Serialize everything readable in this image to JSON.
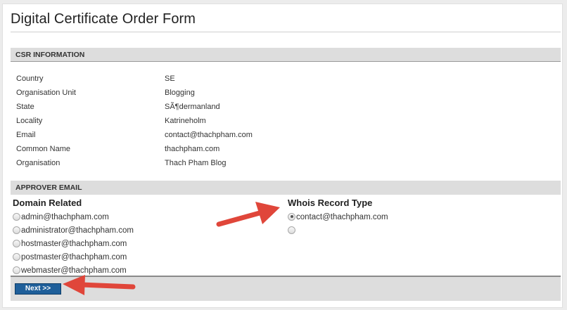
{
  "page": {
    "title": "Digital Certificate Order Form"
  },
  "csr": {
    "heading": "CSR INFORMATION",
    "rows": [
      {
        "label": "Country",
        "value": "SE"
      },
      {
        "label": "Organisation Unit",
        "value": "Blogging"
      },
      {
        "label": "State",
        "value": "SÃ¶dermanland"
      },
      {
        "label": "Locality",
        "value": "Katrineholm"
      },
      {
        "label": "Email",
        "value": "contact@thachpham.com"
      },
      {
        "label": "Common Name",
        "value": "thachpham.com"
      },
      {
        "label": "Organisation",
        "value": "Thach Pham Blog"
      }
    ]
  },
  "approver": {
    "heading": "APPROVER EMAIL",
    "domain_related": {
      "heading": "Domain Related",
      "options": [
        "admin@thachpham.com",
        "administrator@thachpham.com",
        "hostmaster@thachpham.com",
        "postmaster@thachpham.com",
        "webmaster@thachpham.com"
      ]
    },
    "whois": {
      "heading": "Whois Record Type",
      "options": [
        "contact@thachpham.com",
        ""
      ],
      "selected_index": 0
    }
  },
  "footer": {
    "next_label": "Next >>"
  },
  "colors": {
    "section_background": "#dddddd",
    "button_background": "#1f5f9a",
    "annotation_arrow": "#e0463a"
  },
  "icons": [
    "radio-button-icon",
    "annotation-arrow-icon"
  ]
}
